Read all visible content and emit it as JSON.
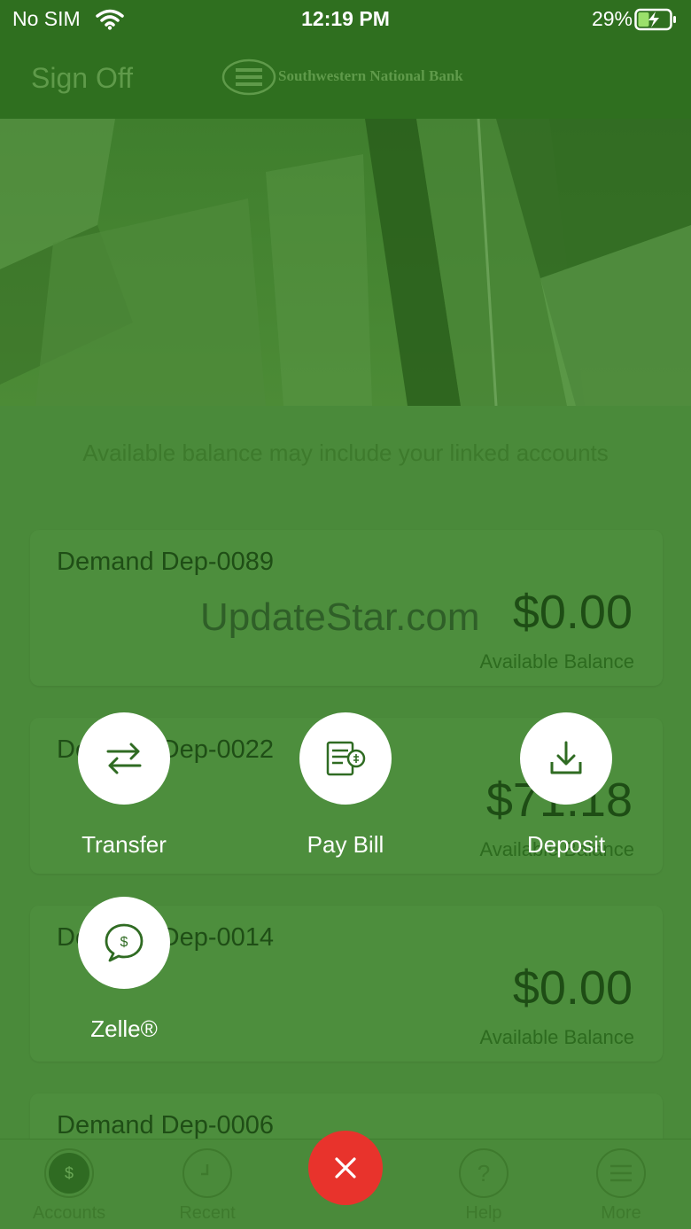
{
  "status": {
    "carrier": "No SIM",
    "time": "12:19 PM",
    "battery": "29%"
  },
  "header": {
    "sign_off": "Sign Off",
    "bank_name": "Southwestern National Bank"
  },
  "note": "Available balance may include your linked accounts",
  "accounts": [
    {
      "name": "Demand Dep-0089",
      "amount": "$0.00",
      "label": "Available Balance"
    },
    {
      "name": "Demand Dep-0022",
      "amount": "$71.18",
      "label": "Available Balance"
    },
    {
      "name": "Demand Dep-0014",
      "amount": "$0.00",
      "label": "Available Balance"
    },
    {
      "name": "Demand Dep-0006"
    }
  ],
  "watermark": "UpdateStar.com",
  "actions": {
    "transfer": "Transfer",
    "pay_bill": "Pay Bill",
    "deposit": "Deposit",
    "zelle": "Zelle®"
  },
  "tabs": {
    "accounts": "Accounts",
    "recent": "Recent",
    "help": "Help",
    "more": "More"
  },
  "icons": {
    "transfer": "arrows-swap-icon",
    "pay_bill": "bill-icon",
    "deposit": "download-tray-icon",
    "zelle": "chat-dollar-icon",
    "close": "close-icon"
  },
  "colors": {
    "header": "#2f6f1f",
    "overlay": "#4a8a3a",
    "close": "#e8332c",
    "accent": "#2f6b22"
  }
}
